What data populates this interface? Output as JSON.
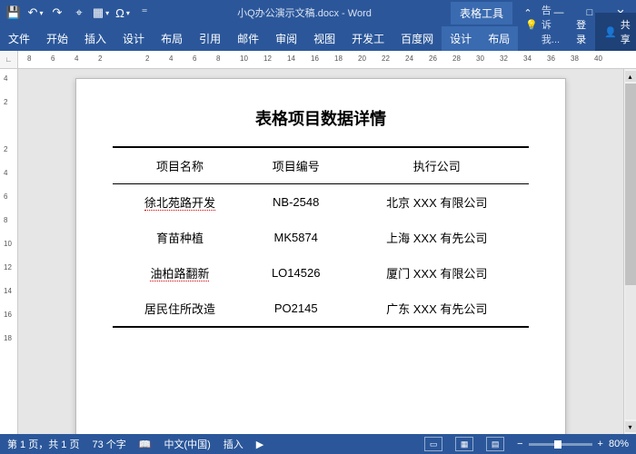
{
  "title": {
    "doc": "小Q办公演示文稿.docx",
    "app": "Word"
  },
  "context_tab": "表格工具",
  "qat": [
    "save",
    "undo",
    "redo",
    "touch",
    "styles",
    "symbol"
  ],
  "window_btns": [
    "min",
    "max",
    "close"
  ],
  "tabs": [
    "文件",
    "开始",
    "插入",
    "设计",
    "布局",
    "引用",
    "邮件",
    "审阅",
    "视图",
    "开发工",
    "百度网"
  ],
  "ctx_tabs": [
    "设计",
    "布局"
  ],
  "tell_me": "告诉我...",
  "login": "登录",
  "share": "共享",
  "h_ruler": [
    8,
    6,
    4,
    2,
    "",
    2,
    4,
    6,
    8,
    10,
    12,
    14,
    16,
    18,
    20,
    22,
    24,
    26,
    28,
    30,
    32,
    34,
    36,
    38,
    40
  ],
  "v_ruler": [
    4,
    2,
    "",
    2,
    4,
    6,
    8,
    10,
    12,
    14,
    16,
    18
  ],
  "document": {
    "title": "表格项目数据详情",
    "headers": [
      "项目名称",
      "项目编号",
      "执行公司"
    ],
    "rows": [
      {
        "c0": "徐北苑路开发",
        "c1": "NB-2548",
        "c2": "北京 XXX 有限公司",
        "spell0": true
      },
      {
        "c0": "育苗种植",
        "c1": "MK5874",
        "c2": "上海 XXX 有先公司",
        "spell0": false
      },
      {
        "c0": "油柏路翻新",
        "c1": "LO14526",
        "c2": "厦门 XXX 有限公司",
        "spell0": true
      },
      {
        "c0": "居民住所改造",
        "c1": "PO2145",
        "c2": "广东 XXX 有先公司",
        "spell0": false
      }
    ]
  },
  "status": {
    "page": "第 1 页，共 1 页",
    "words": "73 个字",
    "proof": "",
    "lang": "中文(中国)",
    "mode": "插入",
    "zoom": "80%"
  }
}
